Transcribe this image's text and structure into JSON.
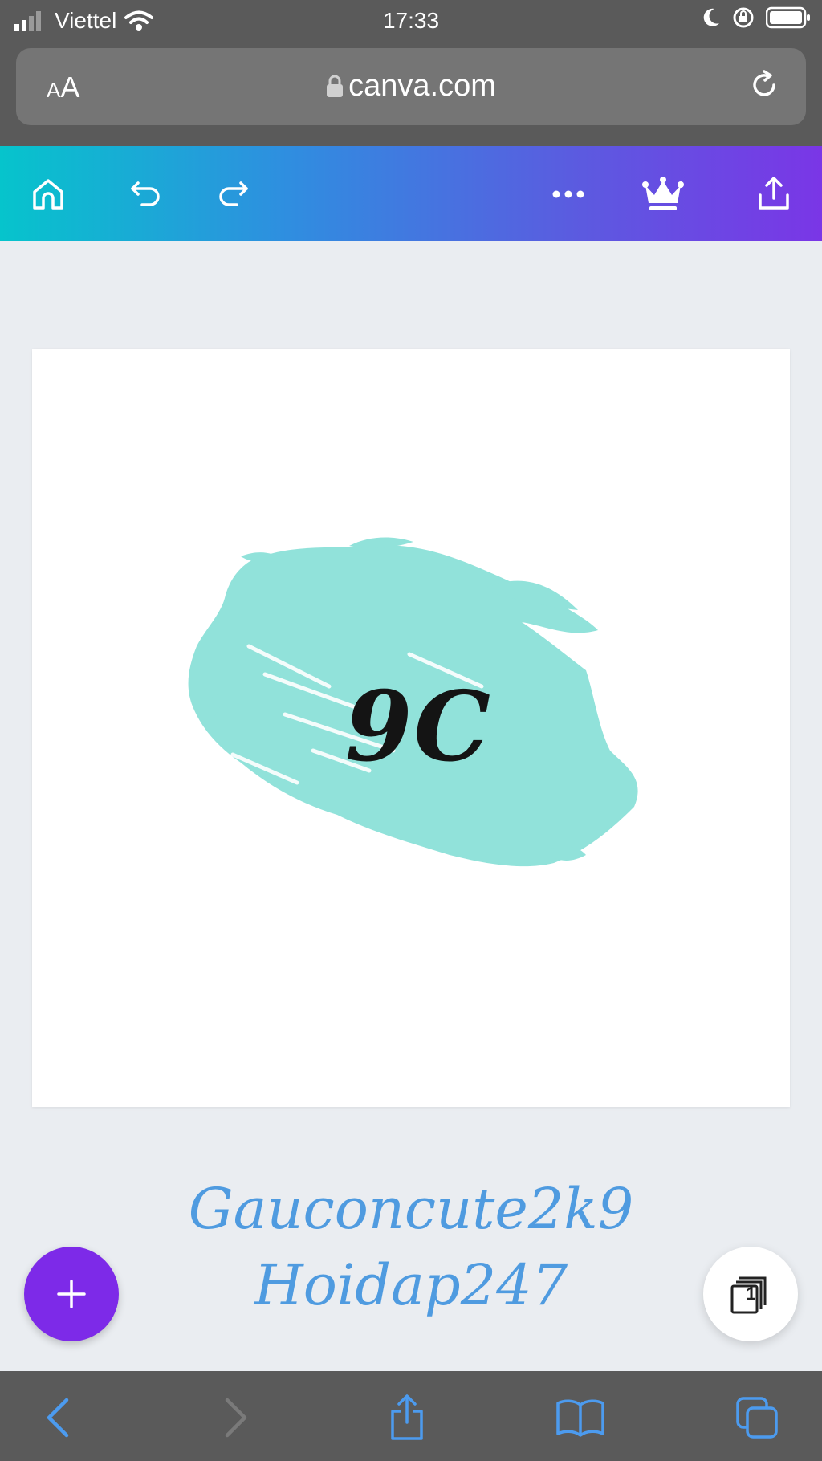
{
  "status": {
    "carrier": "Viettel",
    "time": "17:33"
  },
  "browser": {
    "aa_small": "A",
    "aa_large": "A",
    "domain": "canva.com"
  },
  "design": {
    "text": "9C",
    "brush_color": "#91e2da"
  },
  "watermark": {
    "line1": "Gauconcute2k9",
    "line2": "Hoidap247"
  },
  "pages": {
    "count": "1"
  },
  "colors": {
    "accent": "#7d2ae8",
    "toolbar_start": "#06c4cc",
    "toolbar_end": "#7a36e6",
    "link_blue": "#4f9be0"
  },
  "icons": {
    "toolbar": [
      "home-icon",
      "undo-icon",
      "redo-icon",
      "more-icon",
      "crown-icon",
      "share-icon"
    ],
    "bottom": [
      "back-icon",
      "forward-icon",
      "share-icon",
      "bookmarks-icon",
      "tabs-icon"
    ]
  }
}
